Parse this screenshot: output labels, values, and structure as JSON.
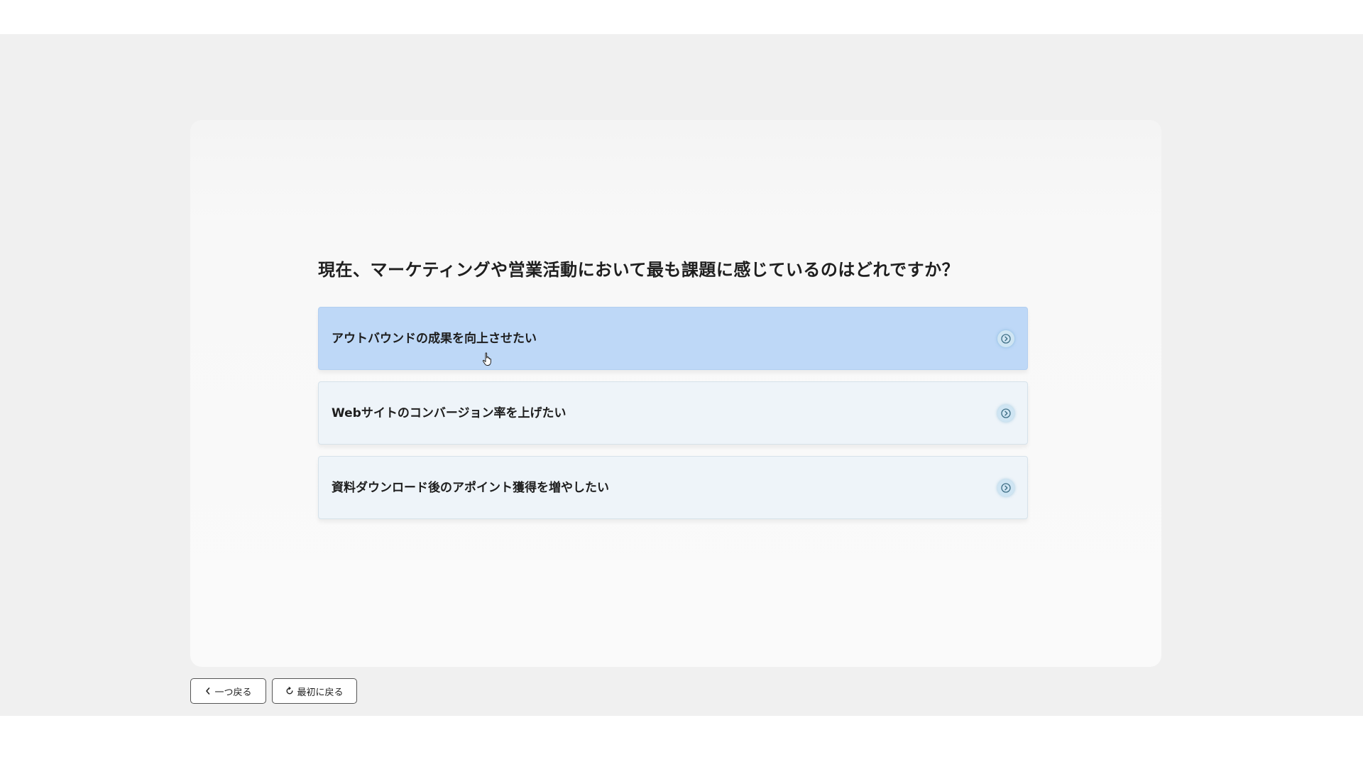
{
  "question": {
    "text": "現在、マーケティングや営業活動において最も課題に感じているのはどれですか？"
  },
  "options": [
    {
      "label": "アウトバウンドの成果を向上させたい",
      "state": "hovered",
      "icon": "chevron-circle-right-icon"
    },
    {
      "label": "Webサイトのコンバージョン率を上げたい",
      "state": "default",
      "icon": "chevron-circle-right-icon"
    },
    {
      "label": "資料ダウンロード後のアポイント獲得を増やしたい",
      "state": "default",
      "icon": "chevron-circle-right-icon"
    }
  ],
  "footer": {
    "back_label": "一つ戻る",
    "back_icon": "chevron-left-icon",
    "restart_label": "最初に戻る",
    "restart_icon": "refresh-icon"
  },
  "colors": {
    "option_active_bg": "#bed8f7",
    "option_default_bg": "#eef4f9",
    "icon_bg": "#cfe5f3",
    "icon_stroke": "#3f6f86"
  }
}
